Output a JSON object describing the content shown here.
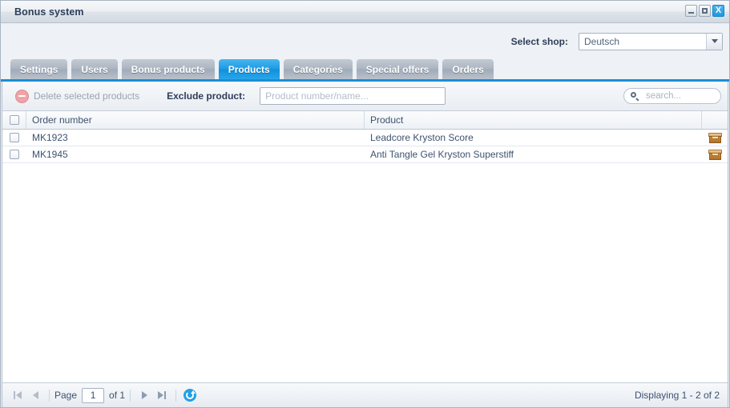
{
  "window": {
    "title": "Bonus system",
    "buttons": {
      "minimize": "minimize-icon",
      "maximize": "maximize-icon",
      "close": "X"
    }
  },
  "shopbar": {
    "label": "Select shop:",
    "selected": "Deutsch"
  },
  "tabs": [
    {
      "label": "Settings",
      "active": false
    },
    {
      "label": "Users",
      "active": false
    },
    {
      "label": "Bonus products",
      "active": false
    },
    {
      "label": "Products",
      "active": true
    },
    {
      "label": "Categories",
      "active": false
    },
    {
      "label": "Special offers",
      "active": false
    },
    {
      "label": "Orders",
      "active": false
    }
  ],
  "toolbar": {
    "delete_label": "Delete selected products",
    "delete_icon": "delete-circle-icon",
    "exclude_label": "Exclude product:",
    "exclude_value": "",
    "exclude_placeholder": "Product number/name...",
    "search_value": "",
    "search_placeholder": "search...",
    "search_icon": "search-icon"
  },
  "grid": {
    "columns": [
      {
        "key": "check",
        "label": ""
      },
      {
        "key": "order",
        "label": "Order number"
      },
      {
        "key": "product",
        "label": "Product"
      },
      {
        "key": "action",
        "label": ""
      }
    ],
    "rows": [
      {
        "order": "MK1923",
        "product": "Leadcore Kryston Score",
        "action_icon": "package-box-icon"
      },
      {
        "order": "MK1945",
        "product": "Anti Tangle Gel Kryston Superstiff",
        "action_icon": "package-box-icon"
      }
    ]
  },
  "pager": {
    "first_icon": "first-page-icon",
    "prev_icon": "previous-page-icon",
    "page_label": "Page",
    "page_value": "1",
    "of_label": "of 1",
    "next_icon": "next-page-icon",
    "last_icon": "last-page-icon",
    "refresh_icon": "refresh-icon",
    "status": "Displaying 1 - 2 of 2"
  },
  "colors": {
    "accent": "#1b8fd6",
    "tab_inactive": "#aab4c0",
    "text": "#3e5270",
    "panel_bg": "#eef1f5"
  }
}
